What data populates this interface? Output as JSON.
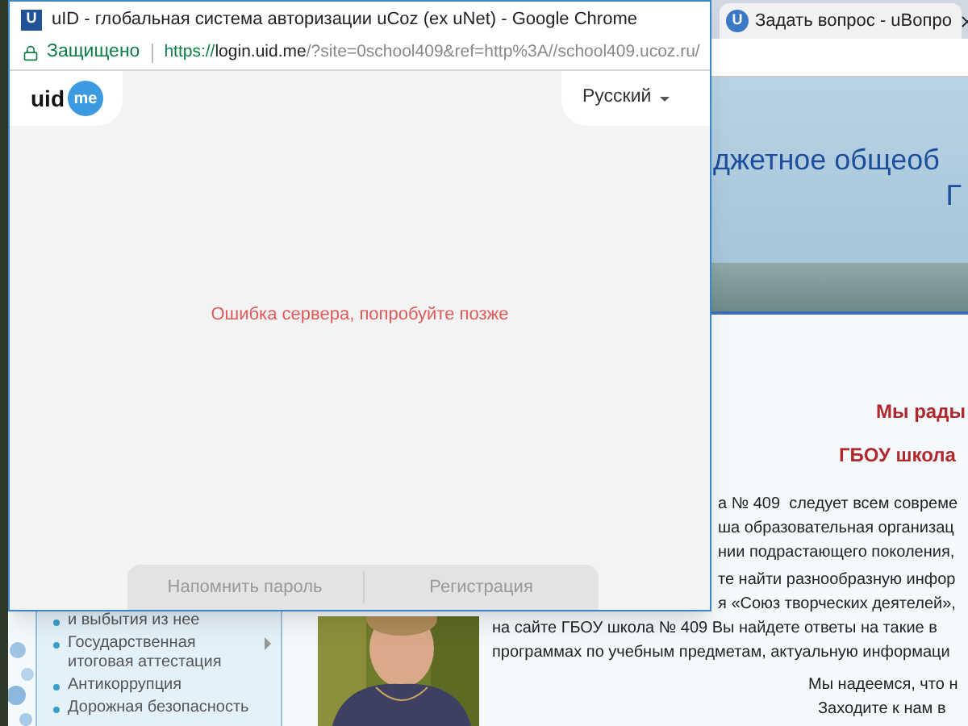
{
  "popup": {
    "favicon": "U",
    "title": "uID - глобальная система авторизации uCoz (ex uNet) - Google Chrome",
    "secure_label": "Защищено",
    "url": {
      "scheme": "https://",
      "host": "login.uid.me",
      "rest": "/?site=0school409&ref=http%3A//school409.ucoz.ru/"
    },
    "logo": {
      "word": "uid",
      "badge": "me"
    },
    "language": "Русский",
    "error": "Ошибка сервера, попробуйте позже",
    "buttons": [
      "Напомнить пароль",
      "Регистрация"
    ]
  },
  "background_tab": {
    "favicon": "U",
    "title": "Задать вопрос - uВопро"
  },
  "site": {
    "header": [
      "джетное общеоб",
      "Г"
    ],
    "welcome": [
      "Мы рады",
      "ГБОУ школа"
    ],
    "body_lines": [
      "а № 409  следует всем совреме",
      "ша образовательная организац",
      "нии подрастающего поколения,",
      "те найти разнообразную инфор",
      "я «Союз творческих деятелей»,",
      "на сайте ГБОУ школа № 409 Вы найдете ответы на такие в",
      "программах по учебным предметам, актуальную информаци"
    ],
    "closing_lines": [
      "Мы надеемся, что н",
      "Заходите к нам в"
    ],
    "sidebar": [
      {
        "label": "и выбытия из нее",
        "submenu": false
      },
      {
        "label": "Государственная итоговая аттестация",
        "submenu": true
      },
      {
        "label": "Антикоррупция",
        "submenu": false
      },
      {
        "label": "Дорожная безопасность",
        "submenu": false
      }
    ]
  }
}
